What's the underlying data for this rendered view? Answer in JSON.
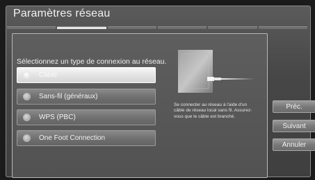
{
  "window": {
    "title": "Paramètres réseau"
  },
  "progress": {
    "segments": 6,
    "active_index": 1
  },
  "main": {
    "prompt": "Sélectionnez un type de connexion au réseau.",
    "options": [
      {
        "label": "Câble",
        "selected": true
      },
      {
        "label": "Sans-fil (généraux)",
        "selected": false
      },
      {
        "label": "WPS (PBC)",
        "selected": false
      },
      {
        "label": "One Foot Connection",
        "selected": false
      }
    ],
    "description": "Se connecter au réseau à l'aide d'un câble de réseau local sans fil. Assurez-vous que le câble est branché.",
    "illustration_icon": "ethernet-cable-icon"
  },
  "nav": {
    "prev_label": "Préc.",
    "next_label": "Suivant",
    "cancel_label": "Annuler"
  },
  "colors": {
    "background": "#4a4a4a",
    "selected_option": "#e5e5e5",
    "button": "#777777"
  }
}
